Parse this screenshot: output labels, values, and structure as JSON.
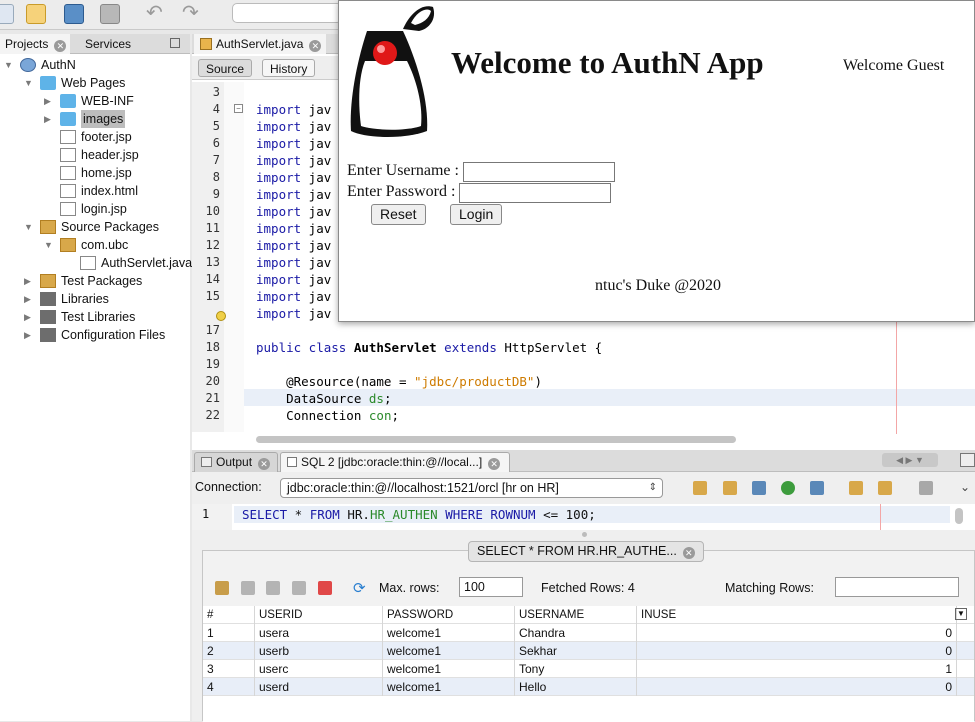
{
  "projects_panel": {
    "tabs": [
      "Projects",
      "Services"
    ],
    "tree": [
      {
        "label": "AuthN",
        "depth": 0,
        "icon": "globe-icon",
        "expanded": true
      },
      {
        "label": "Web Pages",
        "depth": 1,
        "icon": "folder-icon",
        "expanded": true
      },
      {
        "label": "WEB-INF",
        "depth": 2,
        "icon": "folder-icon",
        "expanded": false
      },
      {
        "label": "images",
        "depth": 2,
        "icon": "folder-icon",
        "expanded": false,
        "selected": true
      },
      {
        "label": "footer.jsp",
        "depth": 2,
        "icon": "file-icon"
      },
      {
        "label": "header.jsp",
        "depth": 2,
        "icon": "file-icon"
      },
      {
        "label": "home.jsp",
        "depth": 2,
        "icon": "file-icon"
      },
      {
        "label": "index.html",
        "depth": 2,
        "icon": "file-icon"
      },
      {
        "label": "login.jsp",
        "depth": 2,
        "icon": "file-icon"
      },
      {
        "label": "Source Packages",
        "depth": 1,
        "icon": "package-icon",
        "expanded": true
      },
      {
        "label": "com.ubc",
        "depth": 2,
        "icon": "package-icon",
        "expanded": true
      },
      {
        "label": "AuthServlet.java",
        "depth": 3,
        "icon": "java-file-icon"
      },
      {
        "label": "Test Packages",
        "depth": 1,
        "icon": "package-icon",
        "expanded": false
      },
      {
        "label": "Libraries",
        "depth": 1,
        "icon": "library-icon",
        "expanded": false
      },
      {
        "label": "Test Libraries",
        "depth": 1,
        "icon": "library-icon",
        "expanded": false
      },
      {
        "label": "Configuration Files",
        "depth": 1,
        "icon": "config-icon",
        "expanded": false
      }
    ]
  },
  "editor": {
    "tab": "AuthServlet.java",
    "subtabs": [
      "Source",
      "History"
    ],
    "lines": [
      {
        "n": "3",
        "parts": []
      },
      {
        "n": "4",
        "parts": [
          {
            "t": "import",
            "c": "kw"
          },
          {
            "t": " jav",
            "c": ""
          }
        ]
      },
      {
        "n": "5",
        "parts": [
          {
            "t": "import",
            "c": "kw"
          },
          {
            "t": " jav",
            "c": ""
          }
        ]
      },
      {
        "n": "6",
        "parts": [
          {
            "t": "import",
            "c": "kw"
          },
          {
            "t": " jav",
            "c": ""
          }
        ]
      },
      {
        "n": "7",
        "parts": [
          {
            "t": "import",
            "c": "kw"
          },
          {
            "t": " jav",
            "c": ""
          }
        ]
      },
      {
        "n": "8",
        "parts": [
          {
            "t": "import",
            "c": "kw"
          },
          {
            "t": " jav",
            "c": ""
          }
        ]
      },
      {
        "n": "9",
        "parts": [
          {
            "t": "import",
            "c": "kw"
          },
          {
            "t": " jav",
            "c": ""
          }
        ]
      },
      {
        "n": "10",
        "parts": [
          {
            "t": "import",
            "c": "kw"
          },
          {
            "t": " jav",
            "c": ""
          }
        ]
      },
      {
        "n": "11",
        "parts": [
          {
            "t": "import",
            "c": "kw"
          },
          {
            "t": " jav",
            "c": ""
          }
        ]
      },
      {
        "n": "12",
        "parts": [
          {
            "t": "import",
            "c": "kw"
          },
          {
            "t": " jav",
            "c": ""
          }
        ]
      },
      {
        "n": "13",
        "parts": [
          {
            "t": "import",
            "c": "kw"
          },
          {
            "t": " jav",
            "c": ""
          }
        ]
      },
      {
        "n": "14",
        "parts": [
          {
            "t": "import",
            "c": "kw"
          },
          {
            "t": " jav",
            "c": ""
          }
        ]
      },
      {
        "n": "15",
        "parts": [
          {
            "t": "import",
            "c": "kw"
          },
          {
            "t": " jav",
            "c": ""
          }
        ]
      },
      {
        "n": "",
        "parts": [
          {
            "t": "import",
            "c": "kw"
          },
          {
            "t": " jav",
            "c": ""
          }
        ]
      },
      {
        "n": "17",
        "parts": []
      },
      {
        "n": "18",
        "parts": [
          {
            "t": "public class ",
            "c": "kw"
          },
          {
            "t": "AuthServlet",
            "c": "bold"
          },
          {
            "t": " extends ",
            "c": "kw"
          },
          {
            "t": "HttpServlet {",
            "c": ""
          }
        ]
      },
      {
        "n": "19",
        "parts": []
      },
      {
        "n": "20",
        "parts": [
          {
            "t": "    @Resource(name = ",
            "c": ""
          },
          {
            "t": "\"jdbc/productDB\"",
            "c": "str"
          },
          {
            "t": ")",
            "c": ""
          }
        ]
      },
      {
        "n": "21",
        "parts": [
          {
            "t": "    DataSource ",
            "c": ""
          },
          {
            "t": "ds",
            "c": "fld"
          },
          {
            "t": ";",
            "c": ""
          }
        ]
      },
      {
        "n": "22",
        "parts": [
          {
            "t": "    Connection ",
            "c": ""
          },
          {
            "t": "con",
            "c": "fld"
          },
          {
            "t": ";",
            "c": ""
          }
        ]
      }
    ]
  },
  "app_window": {
    "title": "Welcome to AuthN App",
    "greeting": "Welcome Guest",
    "username_label": "Enter Username :",
    "password_label": "Enter Password :",
    "reset_label": "Reset",
    "login_label": "Login",
    "footer": "ntuc's Duke @2020"
  },
  "bottom": {
    "tabs": [
      "Output",
      "SQL 2 [jdbc:oracle:thin:@//local...]"
    ],
    "connection_label": "Connection:",
    "connection_value": "jdbc:oracle:thin:@//localhost:1521/orcl [hr on HR]",
    "sql_line_number": "1",
    "sql_text": {
      "parts": [
        {
          "t": "SELECT",
          "c": "kw"
        },
        {
          "t": " * ",
          "c": ""
        },
        {
          "t": "FROM",
          "c": "kw"
        },
        {
          "t": " HR.",
          "c": ""
        },
        {
          "t": "HR_AUTHEN",
          "c": "fld"
        },
        {
          "t": " ",
          "c": ""
        },
        {
          "t": "WHERE",
          "c": "kw"
        },
        {
          "t": " ",
          "c": ""
        },
        {
          "t": "ROWNUM",
          "c": "kw"
        },
        {
          "t": " <= 100;",
          "c": ""
        }
      ]
    },
    "result_tab": "SELECT * FROM HR.HR_AUTHE...",
    "max_rows_label": "Max. rows:",
    "max_rows_value": "100",
    "fetched_label": "Fetched Rows: 4",
    "matching_label": "Matching Rows:",
    "columns": [
      "#",
      "USERID",
      "PASSWORD",
      "USERNAME",
      "INUSE"
    ],
    "rows": [
      [
        "1",
        "usera",
        "welcome1",
        "Chandra",
        "0"
      ],
      [
        "2",
        "userb",
        "welcome1",
        "Sekhar",
        "0"
      ],
      [
        "3",
        "userc",
        "welcome1",
        "Tony",
        "1"
      ],
      [
        "4",
        "userd",
        "welcome1",
        "Hello",
        "0"
      ]
    ]
  },
  "colors": {
    "keyword": "#1a1aa6",
    "string": "#ce7b00",
    "field": "#2b8a2b",
    "row_alt": "#e8eef8"
  }
}
